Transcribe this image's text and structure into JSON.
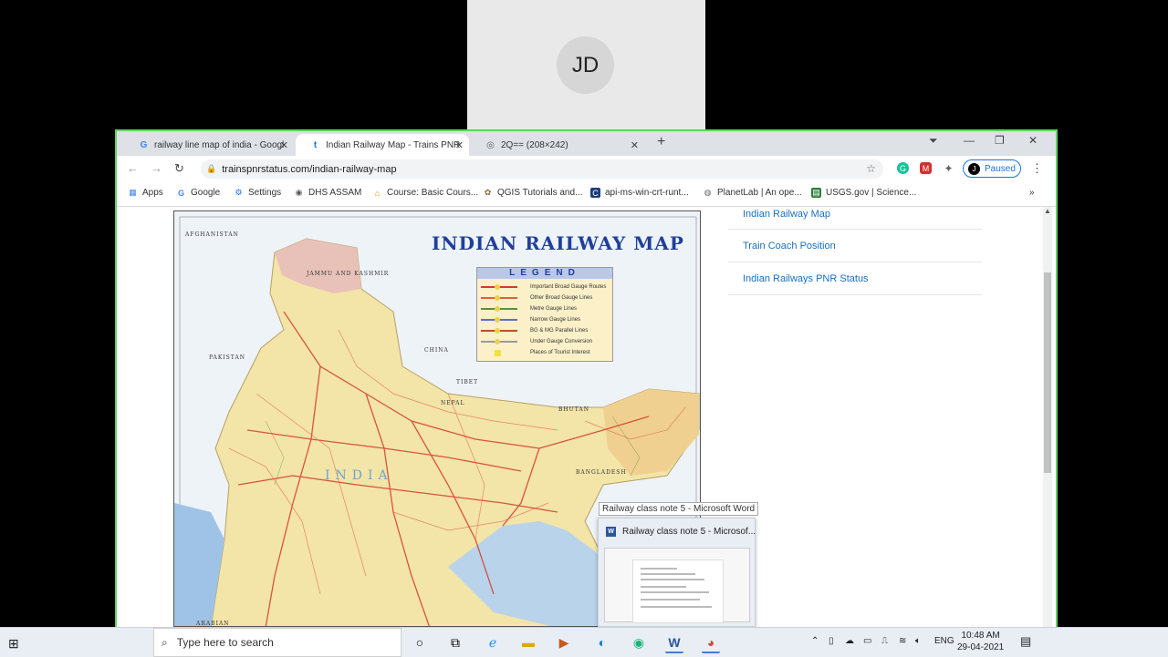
{
  "participant": {
    "initials": "JD"
  },
  "tabs": [
    {
      "title": "railway line map of india - Googl",
      "favicon": "google-icon"
    },
    {
      "title": "Indian Railway Map - Trains PNR",
      "favicon": "trains-icon",
      "active": true
    },
    {
      "title": "2Q== (208×242)",
      "favicon": "globe-icon"
    }
  ],
  "toolbar": {
    "url": "trainspnrstatus.com/indian-railway-map",
    "profile_label": "Paused",
    "profile_initial": "J"
  },
  "bookmarks": [
    {
      "label": "Apps",
      "icon": "apps-grid-icon"
    },
    {
      "label": "Google",
      "icon": "google-icon"
    },
    {
      "label": "Settings",
      "icon": "gear-icon"
    },
    {
      "label": "DHS ASSAM",
      "icon": "globe-icon"
    },
    {
      "label": "Course: Basic Cours...",
      "icon": "course-icon"
    },
    {
      "label": "QGIS Tutorials and...",
      "icon": "qgis-icon"
    },
    {
      "label": "api-ms-win-crt-runt...",
      "icon": "site-icon"
    },
    {
      "label": "PlanetLab | An ope...",
      "icon": "planetlab-icon"
    },
    {
      "label": "USGS.gov | Science...",
      "icon": "usgs-icon"
    }
  ],
  "map": {
    "title": "INDIAN RAILWAY MAP",
    "legend_title": "LEGEND",
    "legend": [
      {
        "label": "Important Broad Gauge Routes",
        "color": "#d33b2c"
      },
      {
        "label": "Other Broad Gauge Lines",
        "color": "#e0603a"
      },
      {
        "label": "Metre Gauge Lines",
        "color": "#5a8f3c"
      },
      {
        "label": "Narrow Gauge Lines",
        "color": "#5b6fd0"
      },
      {
        "label": "BG & MG Parallel Lines",
        "color": "#c24a2a"
      },
      {
        "label": "Under Gauge Conversion",
        "color": "#999999"
      },
      {
        "label": "Places of Tourist Interest",
        "color": "#f2e33a"
      }
    ],
    "labels": {
      "afghanistan": "AFGHANISTAN",
      "pakistan": "PAKISTAN",
      "china": "CHINA",
      "tibet": "TIBET",
      "nepal": "NEPAL",
      "bhutan": "BHUTAN",
      "bangladesh": "BANGLADESH",
      "arabian": "ARABIAN",
      "jk": "JAMMU AND KASHMIR",
      "india": "INDIA"
    }
  },
  "sidebar": {
    "links": [
      "Indian Railway Map",
      "Train Coach Position",
      "Indian Railways PNR Status"
    ]
  },
  "taskbar": {
    "tooltip": "Railway class note 5 - Microsoft Word",
    "preview_title": "Railway class note 5 - Microsof...",
    "search_placeholder": "Type here to search",
    "lang": "ENG",
    "time": "10:48 AM",
    "date": "29-04-2021"
  }
}
